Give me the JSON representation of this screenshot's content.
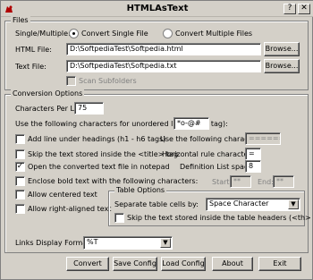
{
  "window": {
    "title": "HTMLAsText"
  },
  "files": {
    "group_title": "Files",
    "single_multiple_label": "Single/Multiple:",
    "convert_single": "Convert Single File",
    "convert_multiple": "Convert Multiple Files",
    "html_file_label": "HTML File:",
    "html_file_value": "D:\\SoftpediaTest\\Softpedia.html",
    "text_file_label": "Text File:",
    "text_file_value": "D:\\SoftpediaTest\\Softpedia.txt",
    "browse_label": "Browse...",
    "scan_subfolders": "Scan Subfolders"
  },
  "conversion": {
    "group_title": "Conversion Options",
    "chars_per_line_label": "Characters Per Line:",
    "chars_per_line_value": "75",
    "unordered_label": "Use the following characters for unordered lists (<ul> tag):",
    "unordered_value": "*o-@#",
    "add_line_label": "Add line under headings (h1 - h6 tags)",
    "use_following_label": "Use the following characters:",
    "use_following_value": "=======",
    "skip_title_label": "Skip the text stored inside the <title> tag",
    "hr_char_label": "Horizontal rule character:",
    "hr_char_value": "=",
    "open_notepad_label": "Open the converted text file in notepad",
    "def_list_label": "Definition List spaces:",
    "def_list_value": "8",
    "enclose_bold_label": "Enclose bold text with the following characters:",
    "start_label": "Start:",
    "start_value": "**",
    "end_label": "End:",
    "end_value": "**",
    "allow_centered": "Allow centered text",
    "allow_right": "Allow right-aligned text"
  },
  "table_options": {
    "group_title": "Table Options",
    "separate_label": "Separate table cells by:",
    "separate_value": "Space Character",
    "skip_th_label": "Skip the text stored inside the table headers (<th> tag)"
  },
  "links": {
    "label": "Links Display Format:",
    "value": "%T"
  },
  "buttons": {
    "convert": "Convert",
    "save_config": "Save Config",
    "load_config": "Load Config",
    "about": "About",
    "exit": "Exit"
  },
  "state": {
    "open_notepad_checked": true
  }
}
